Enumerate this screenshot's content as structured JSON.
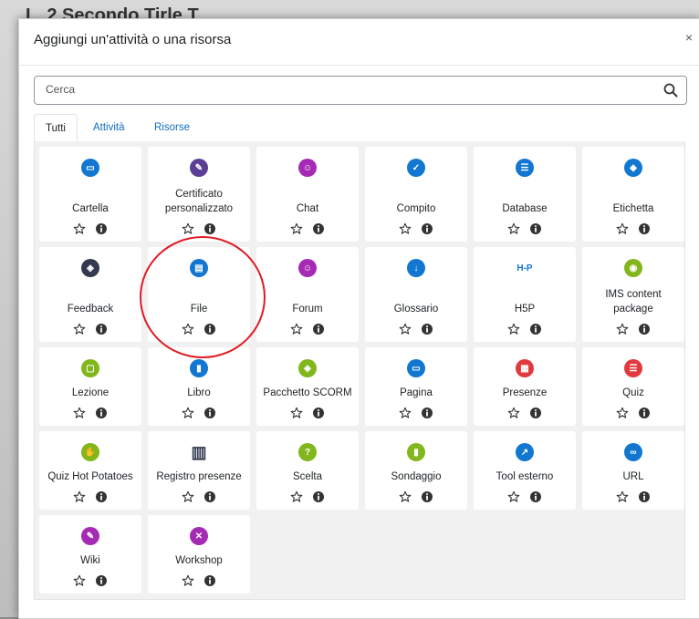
{
  "background": {
    "title": "L. 2 Secondo Tirle T"
  },
  "modal": {
    "title": "Aggiungi un'attività o una risorsa",
    "close": "×"
  },
  "search": {
    "placeholder": "Cerca",
    "value": ""
  },
  "tabs": [
    {
      "label": "Tutti",
      "active": true
    },
    {
      "label": "Attività",
      "active": false
    },
    {
      "label": "Risorse",
      "active": false
    }
  ],
  "items": [
    {
      "label": "Cartella",
      "icon": "folder-icon",
      "color": "#1177d1"
    },
    {
      "label": "Certificato personalizzato",
      "icon": "certificate-icon",
      "color": "#5b3e96"
    },
    {
      "label": "Chat",
      "icon": "chat-icon",
      "color": "#a52ab4"
    },
    {
      "label": "Compito",
      "icon": "assignment-icon",
      "color": "#1177d1"
    },
    {
      "label": "Database",
      "icon": "database-icon",
      "color": "#1177d1"
    },
    {
      "label": "Etichetta",
      "icon": "tag-icon",
      "color": "#1177d1"
    },
    {
      "label": "Feedback",
      "icon": "box-icon",
      "color": "#333a4f"
    },
    {
      "label": "File",
      "icon": "file-icon",
      "color": "#1177d1"
    },
    {
      "label": "Forum",
      "icon": "forum-icon",
      "color": "#a52ab4"
    },
    {
      "label": "Glossario",
      "icon": "sort-icon",
      "color": "#1177d1"
    },
    {
      "label": "H5P",
      "icon": "h5p-icon",
      "color": "#1177d1"
    },
    {
      "label": "IMS content package",
      "icon": "package-icon",
      "color": "#81b71c"
    },
    {
      "label": "Lezione",
      "icon": "presentation-icon",
      "color": "#81b71c"
    },
    {
      "label": "Libro",
      "icon": "book-icon",
      "color": "#1177d1"
    },
    {
      "label": "Pacchetto SCORM",
      "icon": "scorm-icon",
      "color": "#81b71c"
    },
    {
      "label": "Pagina",
      "icon": "page-icon",
      "color": "#1177d1"
    },
    {
      "label": "Presenze",
      "icon": "attendance-icon",
      "color": "#e03a3e"
    },
    {
      "label": "Quiz",
      "icon": "quiz-icon",
      "color": "#e03a3e"
    },
    {
      "label": "Quiz Hot Potatoes",
      "icon": "hand-icon",
      "color": "#81b71c"
    },
    {
      "label": "Registro presenze",
      "icon": "register-icon",
      "color": "#333a4f"
    },
    {
      "label": "Scelta",
      "icon": "question-icon",
      "color": "#81b71c"
    },
    {
      "label": "Sondaggio",
      "icon": "chart-icon",
      "color": "#81b71c"
    },
    {
      "label": "Tool esterno",
      "icon": "external-tool-icon",
      "color": "#1177d1"
    },
    {
      "label": "URL",
      "icon": "link-icon",
      "color": "#1177d1"
    },
    {
      "label": "Wiki",
      "icon": "pencil-icon",
      "color": "#a52ab4"
    },
    {
      "label": "Workshop",
      "icon": "tools-icon",
      "color": "#a52ab4"
    }
  ]
}
